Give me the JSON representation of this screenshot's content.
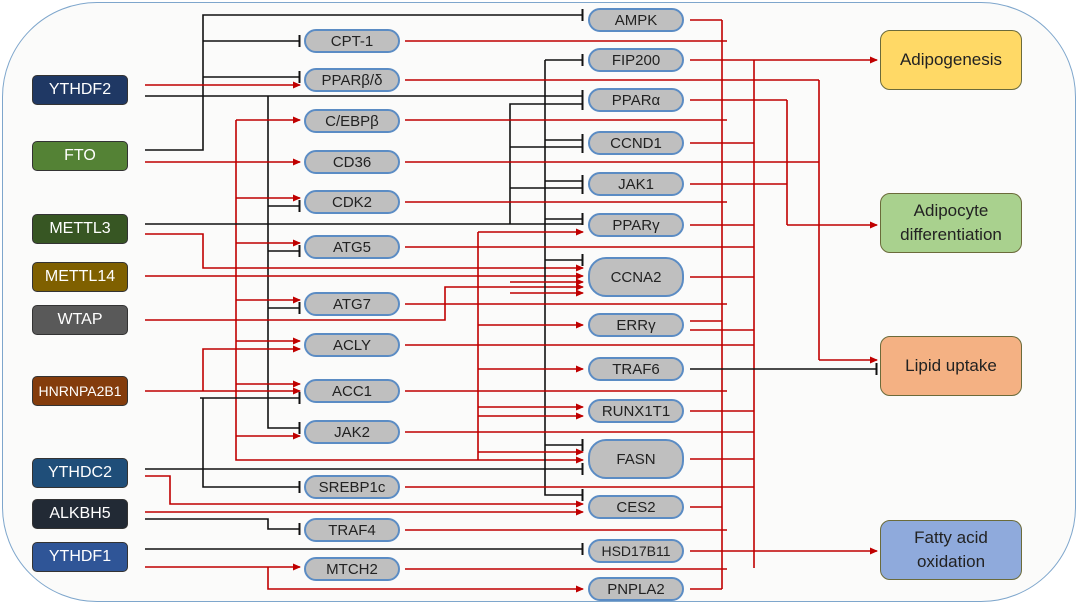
{
  "regulators": [
    {
      "label": "YTHDF2",
      "color": "#1f3864"
    },
    {
      "label": "FTO",
      "color": "#548235"
    },
    {
      "label": "METTL3",
      "color": "#375623"
    },
    {
      "label": "METTL14",
      "color": "#7f6000"
    },
    {
      "label": "WTAP",
      "color": "#595959"
    },
    {
      "label": "HNRNPA2B1",
      "color": "#843c0c"
    },
    {
      "label": "YTHDC2",
      "color": "#1f4e79"
    },
    {
      "label": "ALKBH5",
      "color": "#222a35"
    },
    {
      "label": "YTHDF1",
      "color": "#2f5597"
    }
  ],
  "middle_genes": [
    "CPT-1",
    "PPARβ/δ",
    "C/EBPβ",
    "CD36",
    "CDK2",
    "ATG5",
    "ATG7",
    "ACLY",
    "ACC1",
    "JAK2",
    "SREBP1c",
    "TRAF4",
    "MTCH2"
  ],
  "right_genes": [
    "AMPK",
    "FIP200",
    "PPARα",
    "CCND1",
    "JAK1",
    "PPARγ",
    "CCNA2",
    "ERRγ",
    "TRAF6",
    "RUNX1T1",
    "FASN",
    "CES2",
    "HSD17B11",
    "PNPLA2"
  ],
  "outcomes": [
    {
      "label": "Adipogenesis",
      "color": "#ffd966"
    },
    {
      "label": "Adipocyte differentiation",
      "color": "#a9d18e"
    },
    {
      "label": "Lipid uptake",
      "color": "#f4b183"
    },
    {
      "label": "Fatty acid oxidation",
      "color": "#8faadc"
    }
  ],
  "edge_colors": {
    "promote": "#c00000",
    "inhibit": "#111111"
  }
}
